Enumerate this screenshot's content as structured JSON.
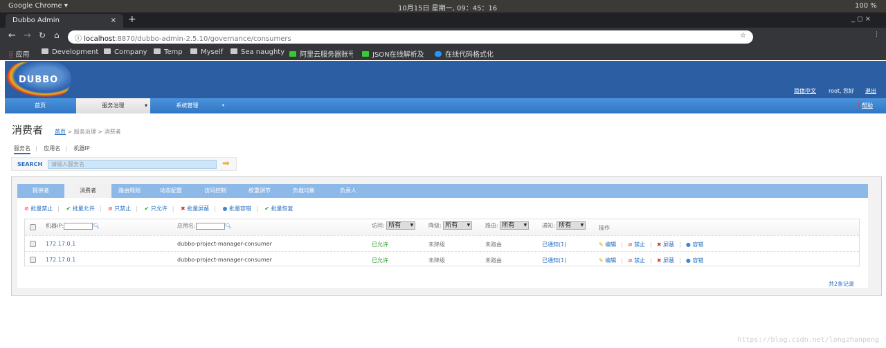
{
  "os": {
    "app": "Google Chrome ▾",
    "clock": "10月15日 星期一, 09：45：16",
    "battery": "100 %"
  },
  "browser": {
    "tab_title": "Dubbo Admin",
    "url_host": "localhost",
    "url_path": ":8870/dubbo-admin-2.5.10/governance/consumers",
    "bookmarks": [
      "应用",
      "Development",
      "Company",
      "Temp",
      "Myself",
      "Sea naughty",
      "阿里云服务器账号",
      "JSON在线解析及",
      "在线代码格式化"
    ]
  },
  "header": {
    "logo": "DUBBO",
    "lang": "简体中文",
    "user": "root, 您好",
    "logout": "退出",
    "help": "帮助"
  },
  "nav": [
    "首页",
    "服务治理",
    "系统管理"
  ],
  "page": {
    "title": "消费者",
    "crumb_home": "首页",
    "crumb_rest": " > 服务治理 > 消费者",
    "search_tabs": [
      "服务名",
      "应用名",
      "机器IP"
    ],
    "search_label": "SEARCH",
    "search_placeholder": "请输入服务名"
  },
  "tabs": [
    "提供者",
    "消费者",
    "路由规则",
    "动态配置",
    "访问控制",
    "权重调节",
    "负载均衡",
    "负责人"
  ],
  "actions": [
    "批量禁止",
    "批量允许",
    "只禁止",
    "只允许",
    "批量屏蔽",
    "批量容错",
    "批量恢复"
  ],
  "table": {
    "h_ip": "机器IP:",
    "h_app": "应用名:",
    "h_access": "访问:",
    "h_degrade": "降级:",
    "h_route": "路由:",
    "h_notify": "通知:",
    "all": "所有",
    "h_ops": "操作",
    "ops": [
      "编辑",
      "禁止",
      "屏蔽",
      "容错"
    ],
    "rows": [
      {
        "ip": "172.17.0.1",
        "app": "dubbo-project-manager-consumer",
        "access": "已允许",
        "degrade": "未降级",
        "route": "未路由",
        "notify": "已通知(1)"
      },
      {
        "ip": "172.17.0.1",
        "app": "dubbo-project-manager-consumer",
        "access": "已允许",
        "degrade": "未降级",
        "route": "未路由",
        "notify": "已通知(1)"
      }
    ]
  },
  "total": "共2条记录",
  "watermark": "https://blog.csdn.net/longzhanpeng"
}
